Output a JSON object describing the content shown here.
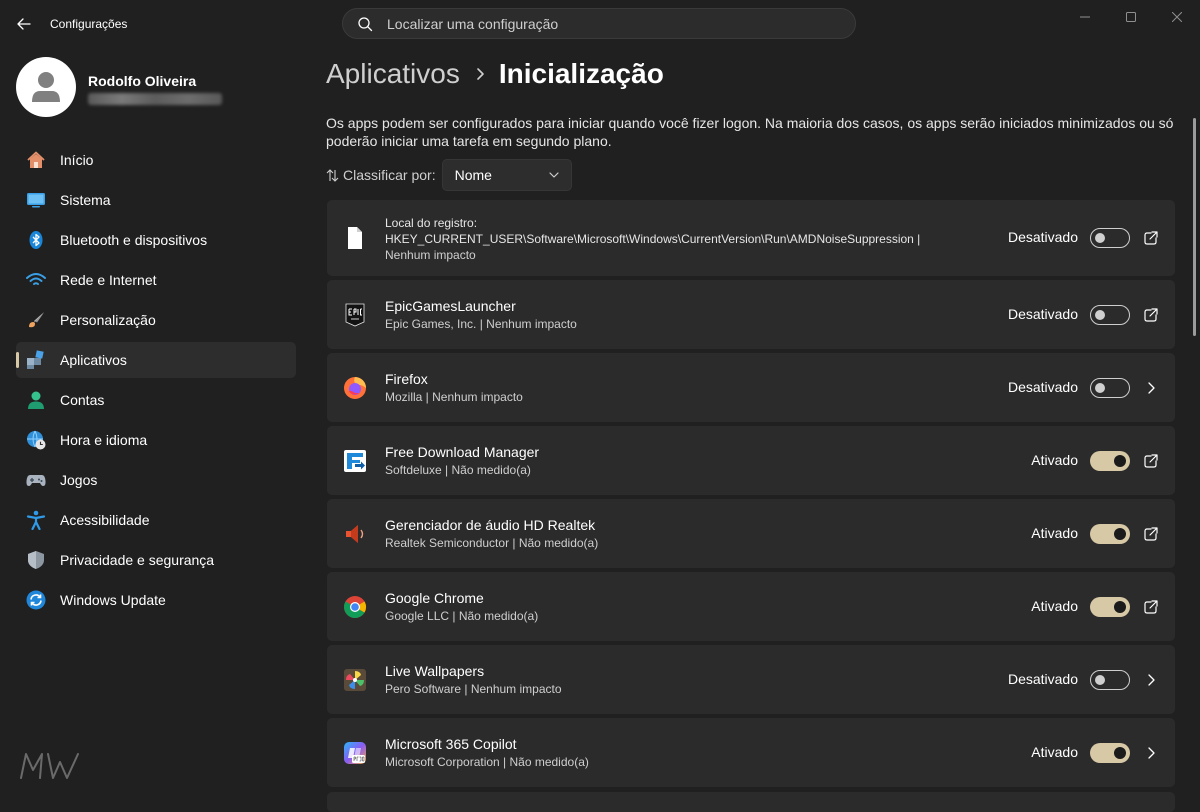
{
  "window": {
    "app_title": "Configurações",
    "search_placeholder": "Localizar uma configuração"
  },
  "profile": {
    "name": "Rodolfo Oliveira"
  },
  "sidebar": {
    "items": [
      {
        "label": "Início",
        "icon": "home-icon"
      },
      {
        "label": "Sistema",
        "icon": "monitor-icon"
      },
      {
        "label": "Bluetooth e dispositivos",
        "icon": "bluetooth-icon"
      },
      {
        "label": "Rede e Internet",
        "icon": "wifi-icon"
      },
      {
        "label": "Personalização",
        "icon": "brush-icon"
      },
      {
        "label": "Aplicativos",
        "icon": "apps-icon",
        "active": true
      },
      {
        "label": "Contas",
        "icon": "person-icon"
      },
      {
        "label": "Hora e idioma",
        "icon": "globe-clock-icon"
      },
      {
        "label": "Jogos",
        "icon": "gamepad-icon"
      },
      {
        "label": "Acessibilidade",
        "icon": "accessibility-icon"
      },
      {
        "label": "Privacidade e segurança",
        "icon": "shield-icon"
      },
      {
        "label": "Windows Update",
        "icon": "sync-icon"
      }
    ],
    "watermark_text": "MW"
  },
  "main": {
    "breadcrumb_parent": "Aplicativos",
    "breadcrumb_current": "Inicialização",
    "description": "Os apps podem ser configurados para iniciar quando você fizer logon. Na maioria dos casos, os apps serão iniciados minimizados ou só poderão iniciar uma tarefa em segundo plano.",
    "sort_label": "Classificar por:",
    "sort_value": "Nome"
  },
  "registry_item": {
    "line1": "Local do registro:",
    "line2": "HKEY_CURRENT_USER\\Software\\Microsoft\\Windows\\CurrentVersion\\Run\\AMDNoiseSuppression   |",
    "line3": "Nenhum impacto",
    "state": "Desativado",
    "enabled": false
  },
  "apps": [
    {
      "name": "EpicGamesLauncher",
      "details": "Epic Games, Inc.   |   Nenhum impacto",
      "state": "Desativado",
      "enabled": false,
      "action": "open"
    },
    {
      "name": "Firefox",
      "details": "Mozilla   |   Nenhum impacto",
      "state": "Desativado",
      "enabled": false,
      "action": "chevron"
    },
    {
      "name": "Free Download Manager",
      "details": "Softdeluxe   |   Não medido(a)",
      "state": "Ativado",
      "enabled": true,
      "action": "open"
    },
    {
      "name": "Gerenciador de áudio HD Realtek",
      "details": "Realtek Semiconductor   |   Não medido(a)",
      "state": "Ativado",
      "enabled": true,
      "action": "open"
    },
    {
      "name": "Google Chrome",
      "details": "Google LLC   |   Não medido(a)",
      "state": "Ativado",
      "enabled": true,
      "action": "open"
    },
    {
      "name": "Live Wallpapers",
      "details": "Pero Software   |   Nenhum impacto",
      "state": "Desativado",
      "enabled": false,
      "action": "chevron"
    },
    {
      "name": "Microsoft 365 Copilot",
      "details": "Microsoft Corporation   |   Não medido(a)",
      "state": "Ativado",
      "enabled": true,
      "action": "chevron"
    }
  ],
  "colors": {
    "background": "#202020",
    "card": "#2b2b2b",
    "accent": "#d7c8a6",
    "text": "#ffffff",
    "muted_text": "#cfcfcf"
  }
}
